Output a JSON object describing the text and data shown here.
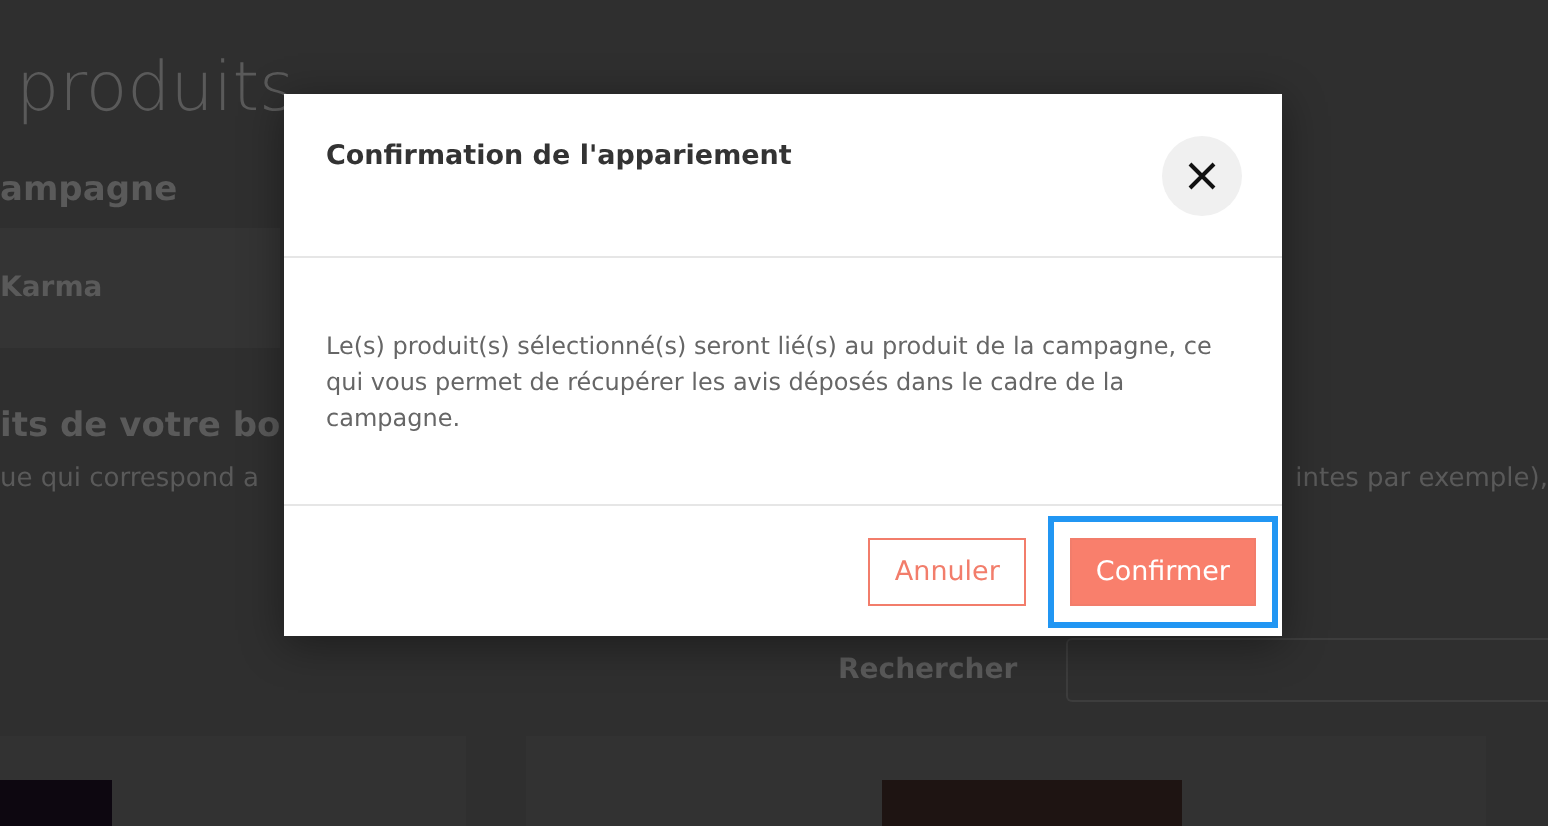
{
  "page": {
    "title": "produits",
    "campaign_heading": "ampagne",
    "campaign_product": "Karma",
    "shop_heading": "its de votre bo",
    "shop_text_left": "ue qui correspond a",
    "shop_text_right": "intes par exemple),",
    "search_label": "Rechercher"
  },
  "dialog": {
    "title": "Confirmation de l'appariement",
    "message": "Le(s) produit(s) sélectionné(s) seront lié(s) au produit de la campagne, ce qui vous permet de récupérer les avis déposés dans le cadre de la campagne.",
    "buttons": [
      {
        "label": "Annuler",
        "kind": "secondary",
        "focused": false
      },
      {
        "label": "Confirmer",
        "kind": "primary",
        "focused": true
      }
    ]
  }
}
